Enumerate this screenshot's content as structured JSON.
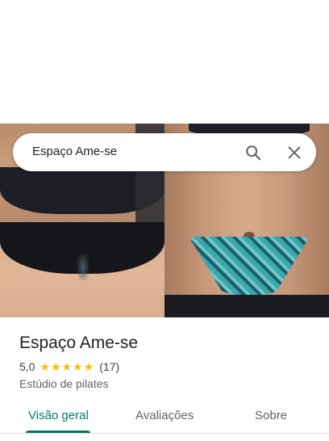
{
  "search": {
    "query": "Espaço Ame-se"
  },
  "place": {
    "title": "Espaço Ame-se",
    "rating": "5,0",
    "stars": 5,
    "review_count": "(17)",
    "category": "Estúdio de pilates"
  },
  "tabs": [
    {
      "label": "Visão geral",
      "active": true
    },
    {
      "label": "Avaliações",
      "active": false
    },
    {
      "label": "Sobre",
      "active": false
    }
  ],
  "colors": {
    "accent": "#00796b",
    "star": "#fbbc04"
  },
  "icons": {
    "search": "search-icon",
    "close": "close-icon",
    "star": "star-icon"
  }
}
